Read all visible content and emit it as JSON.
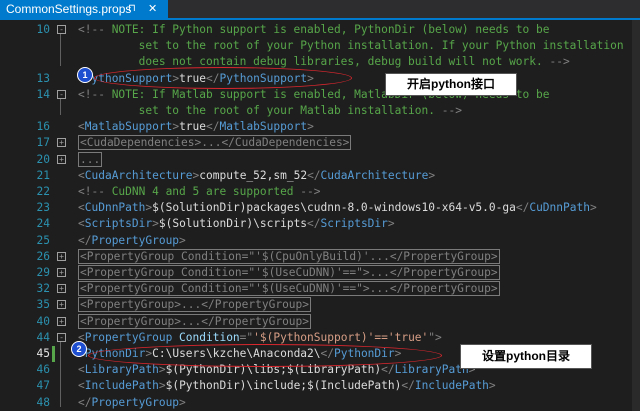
{
  "tab": {
    "title": "CommonSettings.props",
    "pin_icon": "⊓",
    "close_icon": "✕"
  },
  "lines": [
    {
      "num": "10",
      "fold": "-",
      "box": false,
      "parts": [
        {
          "c": "p",
          "t": "<!--"
        },
        {
          "c": "c",
          "t": " NOTE: If Python support is enabled, PythonDir (below) needs to be"
        }
      ]
    },
    {
      "num": "",
      "fold": "",
      "box": false,
      "parts": [
        {
          "c": "c",
          "t": "         set to the root of your Python installation. If your Python installation"
        }
      ]
    },
    {
      "num": "",
      "fold": "",
      "box": false,
      "parts": [
        {
          "c": "c",
          "t": "         does not contain debug libraries, debug build will not work. "
        },
        {
          "c": "p",
          "t": "-->"
        }
      ]
    },
    {
      "num": "13",
      "fold": "",
      "box": false,
      "parts": [
        {
          "c": "p",
          "t": "<"
        },
        {
          "c": "t",
          "t": "PythonSupport"
        },
        {
          "c": "p",
          "t": ">"
        },
        {
          "c": "v",
          "t": "true"
        },
        {
          "c": "p",
          "t": "</"
        },
        {
          "c": "t",
          "t": "PythonSupport"
        },
        {
          "c": "p",
          "t": ">"
        }
      ]
    },
    {
      "num": "14",
      "fold": "-",
      "box": false,
      "parts": [
        {
          "c": "p",
          "t": "<!--"
        },
        {
          "c": "c",
          "t": " NOTE: If Matlab support is enabled, MatlabDir (below) needs to be"
        }
      ]
    },
    {
      "num": "",
      "fold": "",
      "box": false,
      "parts": [
        {
          "c": "c",
          "t": "         set to the root of your Matlab installation. "
        },
        {
          "c": "p",
          "t": "-->"
        }
      ]
    },
    {
      "num": "16",
      "fold": "",
      "box": false,
      "parts": [
        {
          "c": "p",
          "t": "<"
        },
        {
          "c": "t",
          "t": "MatlabSupport"
        },
        {
          "c": "p",
          "t": ">"
        },
        {
          "c": "v",
          "t": "true"
        },
        {
          "c": "p",
          "t": "</"
        },
        {
          "c": "t",
          "t": "MatlabSupport"
        },
        {
          "c": "p",
          "t": ">"
        }
      ]
    },
    {
      "num": "17",
      "fold": "+",
      "box": true,
      "parts": [
        {
          "c": "p",
          "t": "<CudaDependencies>...</CudaDependencies>"
        }
      ]
    },
    {
      "num": "20",
      "fold": "+",
      "box": true,
      "parts": [
        {
          "c": "p",
          "t": "..."
        }
      ]
    },
    {
      "num": "21",
      "fold": "",
      "box": false,
      "parts": [
        {
          "c": "p",
          "t": "<"
        },
        {
          "c": "t",
          "t": "CudaArchitecture"
        },
        {
          "c": "p",
          "t": ">"
        },
        {
          "c": "v",
          "t": "compute_52,sm_52"
        },
        {
          "c": "p",
          "t": "</"
        },
        {
          "c": "t",
          "t": "CudaArchitecture"
        },
        {
          "c": "p",
          "t": ">"
        }
      ]
    },
    {
      "num": "22",
      "fold": "",
      "box": false,
      "parts": [
        {
          "c": "p",
          "t": "<!--"
        },
        {
          "c": "c",
          "t": " CuDNN 4 and 5 are supported "
        },
        {
          "c": "p",
          "t": "-->"
        }
      ]
    },
    {
      "num": "23",
      "fold": "",
      "box": false,
      "parts": [
        {
          "c": "p",
          "t": "<"
        },
        {
          "c": "t",
          "t": "CuDnnPath"
        },
        {
          "c": "p",
          "t": ">"
        },
        {
          "c": "v",
          "t": "$(SolutionDir)packages\\cudnn-8.0-windows10-x64-v5.0-ga"
        },
        {
          "c": "p",
          "t": "</"
        },
        {
          "c": "t",
          "t": "CuDnnPath"
        },
        {
          "c": "p",
          "t": ">"
        }
      ]
    },
    {
      "num": "24",
      "fold": "",
      "box": false,
      "parts": [
        {
          "c": "p",
          "t": "<"
        },
        {
          "c": "t",
          "t": "ScriptsDir"
        },
        {
          "c": "p",
          "t": ">"
        },
        {
          "c": "v",
          "t": "$(SolutionDir)\\scripts"
        },
        {
          "c": "p",
          "t": "</"
        },
        {
          "c": "t",
          "t": "ScriptsDir"
        },
        {
          "c": "p",
          "t": ">"
        }
      ]
    },
    {
      "num": "25",
      "fold": "",
      "box": false,
      "parts": [
        {
          "c": "p",
          "t": "</"
        },
        {
          "c": "t",
          "t": "PropertyGroup"
        },
        {
          "c": "p",
          "t": ">"
        }
      ]
    },
    {
      "num": "26",
      "fold": "+",
      "box": true,
      "parts": [
        {
          "c": "p",
          "t": "<PropertyGroup Condition=\"'$(CpuOnlyBuild)'...</PropertyGroup>"
        }
      ]
    },
    {
      "num": "29",
      "fold": "+",
      "box": true,
      "parts": [
        {
          "c": "p",
          "t": "<PropertyGroup Condition=\"'$(UseCuDNN)'==\">...</PropertyGroup>"
        }
      ]
    },
    {
      "num": "32",
      "fold": "+",
      "box": true,
      "parts": [
        {
          "c": "p",
          "t": "<PropertyGroup Condition=\"'$(UseCuDNN)'==\">...</PropertyGroup>"
        }
      ]
    },
    {
      "num": "35",
      "fold": "+",
      "box": true,
      "parts": [
        {
          "c": "p",
          "t": "<PropertyGroup>...</PropertyGroup>"
        }
      ]
    },
    {
      "num": "40",
      "fold": "+",
      "box": true,
      "parts": [
        {
          "c": "p",
          "t": "<PropertyGroup>...</PropertyGroup>"
        }
      ]
    },
    {
      "num": "44",
      "fold": "-",
      "box": false,
      "parts": [
        {
          "c": "p",
          "t": "<"
        },
        {
          "c": "t",
          "t": "PropertyGroup"
        },
        {
          "c": "a",
          "t": " Condition"
        },
        {
          "c": "p",
          "t": "=\""
        },
        {
          "c": "s",
          "t": "'$(PythonSupport)'=='true'"
        },
        {
          "c": "p",
          "t": "\">"
        }
      ]
    },
    {
      "num": "45",
      "fold": "",
      "box": false,
      "cur": true,
      "parts": [
        {
          "c": "p",
          "t": "<"
        },
        {
          "c": "t",
          "t": "PythonDir"
        },
        {
          "c": "p",
          "t": ">"
        },
        {
          "c": "v",
          "t": "C:\\Users\\kzche\\Anaconda2\\"
        },
        {
          "c": "p",
          "t": "</"
        },
        {
          "c": "t",
          "t": "PythonDir"
        },
        {
          "c": "p",
          "t": ">"
        }
      ]
    },
    {
      "num": "46",
      "fold": "",
      "box": false,
      "parts": [
        {
          "c": "p",
          "t": "<"
        },
        {
          "c": "t",
          "t": "LibraryPath"
        },
        {
          "c": "p",
          "t": ">"
        },
        {
          "c": "v",
          "t": "$(PythonDir)\\libs;$(LibraryPath)"
        },
        {
          "c": "p",
          "t": "</"
        },
        {
          "c": "t",
          "t": "LibraryPath"
        },
        {
          "c": "p",
          "t": ">"
        }
      ]
    },
    {
      "num": "47",
      "fold": "",
      "box": false,
      "parts": [
        {
          "c": "p",
          "t": "<"
        },
        {
          "c": "t",
          "t": "IncludePath"
        },
        {
          "c": "p",
          "t": ">"
        },
        {
          "c": "v",
          "t": "$(PythonDir)\\include;$(IncludePath)"
        },
        {
          "c": "p",
          "t": "</"
        },
        {
          "c": "t",
          "t": "IncludePath"
        },
        {
          "c": "p",
          "t": ">"
        }
      ]
    },
    {
      "num": "48",
      "fold": "",
      "box": false,
      "parts": [
        {
          "c": "p",
          "t": "</"
        },
        {
          "c": "t",
          "t": "PropertyGroup"
        },
        {
          "c": "p",
          "t": ">"
        }
      ]
    }
  ],
  "annotations": {
    "badge1": "1",
    "badge2": "2",
    "callout1": "开启python接口",
    "callout2": "设置python目录"
  },
  "colors": {
    "accent": "#007acc",
    "comment": "#57a64a",
    "tag": "#569cd6",
    "highlight": "#d9272e"
  }
}
